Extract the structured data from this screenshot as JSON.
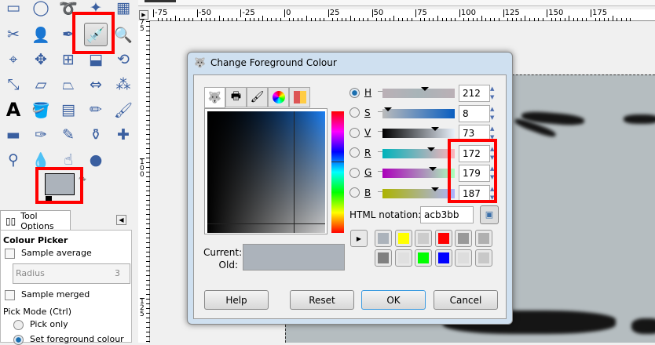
{
  "toolbox": {
    "tools": [
      "rect-select",
      "ellipse-select",
      "free-select",
      "fuzzy-select",
      "select-by-color",
      "scissors",
      "foreground-select",
      "paths",
      "color-picker",
      "zoom",
      "measure",
      "move",
      "align",
      "crop",
      "rotate",
      "scale",
      "shear",
      "perspective",
      "flip",
      "cage",
      "text",
      "bucket-fill",
      "blend",
      "pencil",
      "paintbrush",
      "eraser",
      "airbrush",
      "ink",
      "clone",
      "heal",
      "perspective-clone",
      "blur",
      "smudge",
      "dodge-burn"
    ],
    "foreground_color": "#acb3bb"
  },
  "tool_options": {
    "tab_label": "Tool Options",
    "title": "Colour Picker",
    "sample_average": "Sample average",
    "radius_label": "Radius",
    "radius_value": "3",
    "sample_merged": "Sample merged",
    "pick_mode": "Pick Mode  (Ctrl)",
    "pick_only": "Pick only",
    "set_fg": "Set foreground colour"
  },
  "ruler": {
    "h_labels": [
      "-75",
      "-50",
      "-25",
      "0",
      "25",
      "50",
      "75",
      "100",
      "125",
      "150",
      "175"
    ],
    "v_labels": [
      "75",
      "100",
      "125"
    ]
  },
  "dialog": {
    "title": "Change Foreground Colour",
    "current_label": "Current:",
    "old_label": "Old:",
    "channels": [
      {
        "label": "H",
        "value": "212"
      },
      {
        "label": "S",
        "value": "8"
      },
      {
        "label": "V",
        "value": "73"
      },
      {
        "label": "R",
        "value": "172"
      },
      {
        "label": "G",
        "value": "179"
      },
      {
        "label": "B",
        "value": "187"
      }
    ],
    "html_label": "HTML notation:",
    "html_value": "acb3bb",
    "history": [
      "#acb3bb",
      "#ffff00",
      "#cccccc",
      "#ff0000",
      "#999999",
      "#b0b0b0",
      "#808080",
      "#e0e0e0",
      "#00ff00",
      "#0000ff",
      "#dddddd",
      "#c8c8c8"
    ],
    "buttons": {
      "help": "Help",
      "reset": "Reset",
      "ok": "OK",
      "cancel": "Cancel"
    }
  }
}
